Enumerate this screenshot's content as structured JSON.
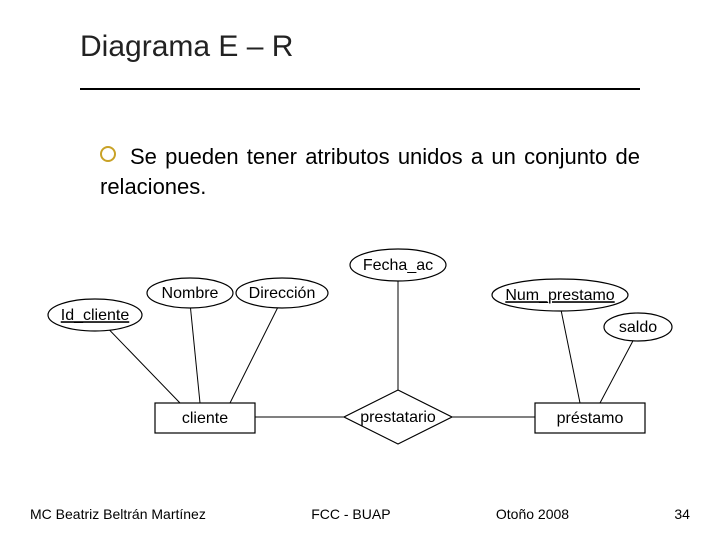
{
  "title": "Diagrama E – R",
  "bullet": "Se pueden tener atributos unidos a un conjunto de relaciones.",
  "diagram": {
    "attributes": {
      "id_cliente": "Id_cliente",
      "nombre": "Nombre",
      "direccion": "Dirección",
      "fecha_ac": "Fecha_ac",
      "num_prestamo": "Num_prestamo",
      "saldo": "saldo"
    },
    "entities": {
      "cliente": "cliente",
      "prestamo": "préstamo"
    },
    "relationship": "prestatario"
  },
  "footer": {
    "left": "MC Beatriz Beltrán Martínez",
    "center": "FCC - BUAP",
    "right_term": "Otoño 2008",
    "page": "34"
  }
}
